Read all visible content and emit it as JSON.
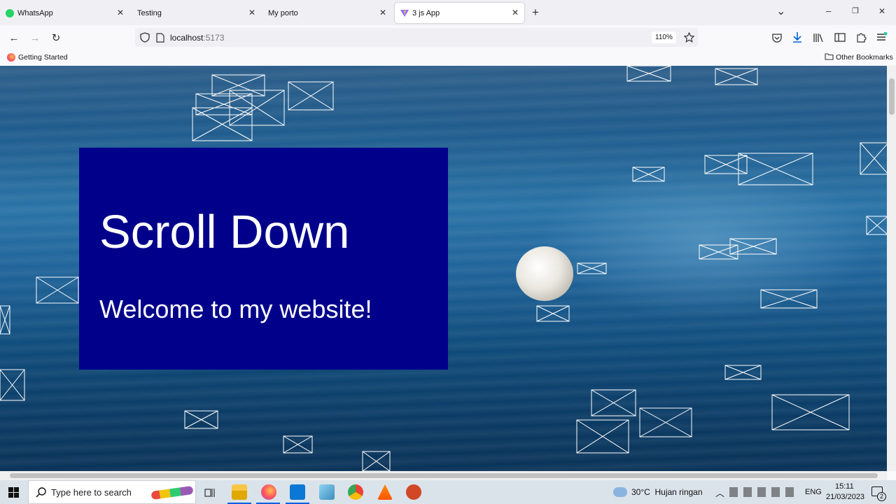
{
  "tabs": [
    {
      "label": "WhatsApp",
      "close": "✕"
    },
    {
      "label": "Testing",
      "close": "✕"
    },
    {
      "label": "My porto",
      "close": "✕"
    },
    {
      "label": "3 js App",
      "close": "✕"
    }
  ],
  "tabbar": {
    "new_tab": "+",
    "list": "⌄",
    "minimize": "–",
    "maximize": "❐",
    "close": "✕"
  },
  "nav": {
    "back": "←",
    "forward": "→",
    "reload": "↻"
  },
  "url": {
    "host": "localhost",
    "port": ":5173",
    "zoom": "110%"
  },
  "bookmarks": {
    "getting_started": "Getting Started",
    "other": "Other Bookmarks"
  },
  "page": {
    "title": "Scroll Down",
    "subtitle": "Welcome to my website!"
  },
  "taskbar": {
    "search_placeholder": "Type here to search",
    "weather": "30°C  Hujan ringan",
    "lang": "ENG",
    "time": "15:11",
    "date": "21/03/2023",
    "notifications": "2"
  },
  "colors": {
    "card": "#00008b",
    "ocean": "#1f5b8c",
    "accent": "#0060df"
  }
}
